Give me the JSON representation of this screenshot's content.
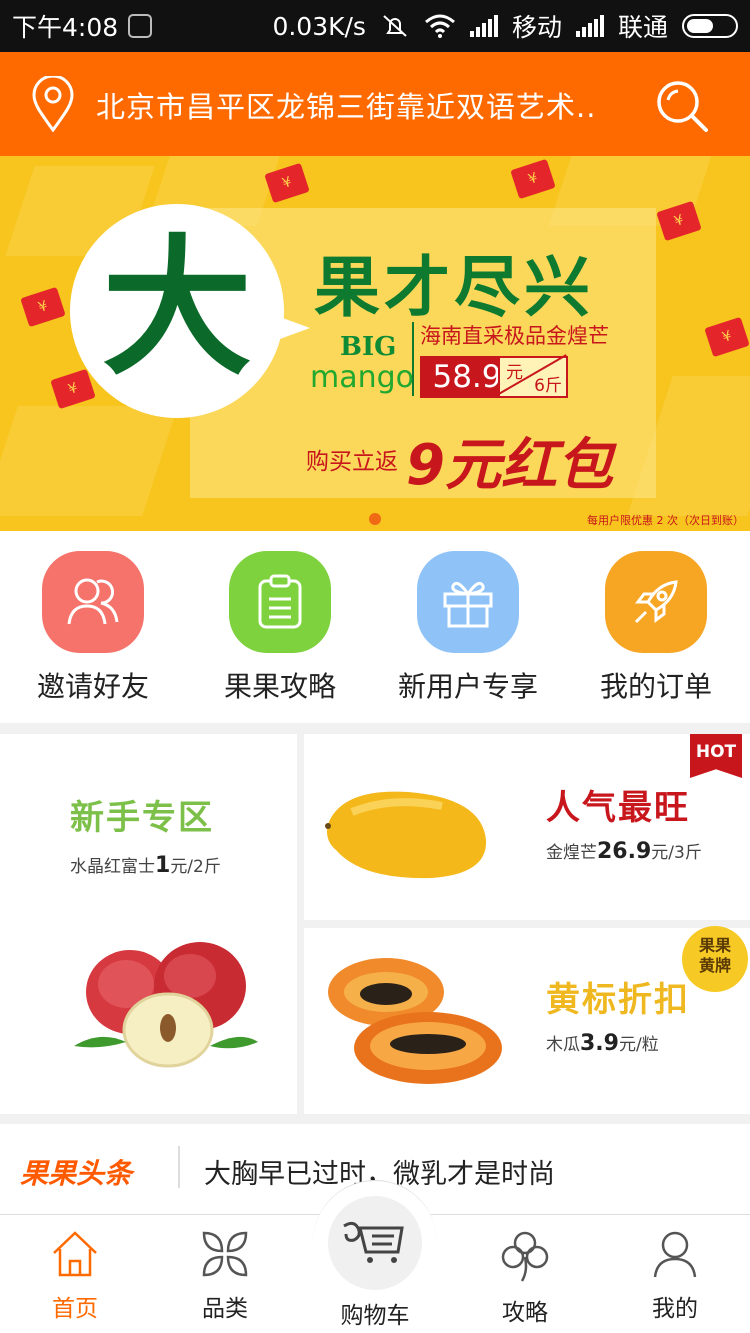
{
  "status_bar": {
    "time": "下午4:08",
    "network_speed": "0.03K/s",
    "carrier1": "移动",
    "carrier2": "联通"
  },
  "header": {
    "location": "北京市昌平区龙锦三街靠近双语艺术..."
  },
  "banner": {
    "big_char": "大",
    "title": "果才尽兴",
    "big_label": "BIG",
    "mango_label": "mango",
    "subtitle": "海南直采极品金煌芒",
    "price": "58.9",
    "unit_top": "元",
    "unit_bottom": "6斤",
    "rebate_label": "购买立返",
    "rebate_amount": "9元红包",
    "footnote": "每用户限优惠 2 次（次日到账）",
    "envelope_glyph": "¥"
  },
  "quick_menu": [
    {
      "label": "邀请好友",
      "color": "#f5736a",
      "icon": "users-icon"
    },
    {
      "label": "果果攻略",
      "color": "#7ed23d",
      "icon": "clipboard-icon"
    },
    {
      "label": "新用户专享",
      "color": "#8fc3f7",
      "icon": "gift-icon"
    },
    {
      "label": "我的订单",
      "color": "#f7a623",
      "icon": "rocket-icon"
    }
  ],
  "promos": {
    "newbie": {
      "title": "新手专区",
      "sub_prefix": "水晶红富士",
      "sub_price": "1",
      "sub_suffix": "元/2斤",
      "color": "#7cc04a"
    },
    "popular": {
      "title": "人气最旺",
      "sub_prefix": "金煌芒",
      "sub_price": "26.9",
      "sub_suffix": "元/3斤",
      "badge": "HOT",
      "color": "#c8161d"
    },
    "discount": {
      "title": "黄标折扣",
      "sub_prefix": "木瓜",
      "sub_price": "3.9",
      "sub_suffix": "元/粒",
      "badge": "果果黄牌",
      "color": "#f0b820"
    }
  },
  "news": {
    "brand": "果果头条",
    "headline": "大胸早已过时，微乳才是时尚"
  },
  "tabs": [
    {
      "label": "首页",
      "icon": "home-icon",
      "active": true
    },
    {
      "label": "品类",
      "icon": "category-icon",
      "active": false
    },
    {
      "label": "购物车",
      "icon": "cart-icon",
      "active": false
    },
    {
      "label": "攻略",
      "icon": "clover-icon",
      "active": false
    },
    {
      "label": "我的",
      "icon": "profile-icon",
      "active": false
    }
  ],
  "colors": {
    "accent": "#ff6a00",
    "banner_bg": "#f7c51e",
    "brand_green": "#0b6a2a"
  }
}
